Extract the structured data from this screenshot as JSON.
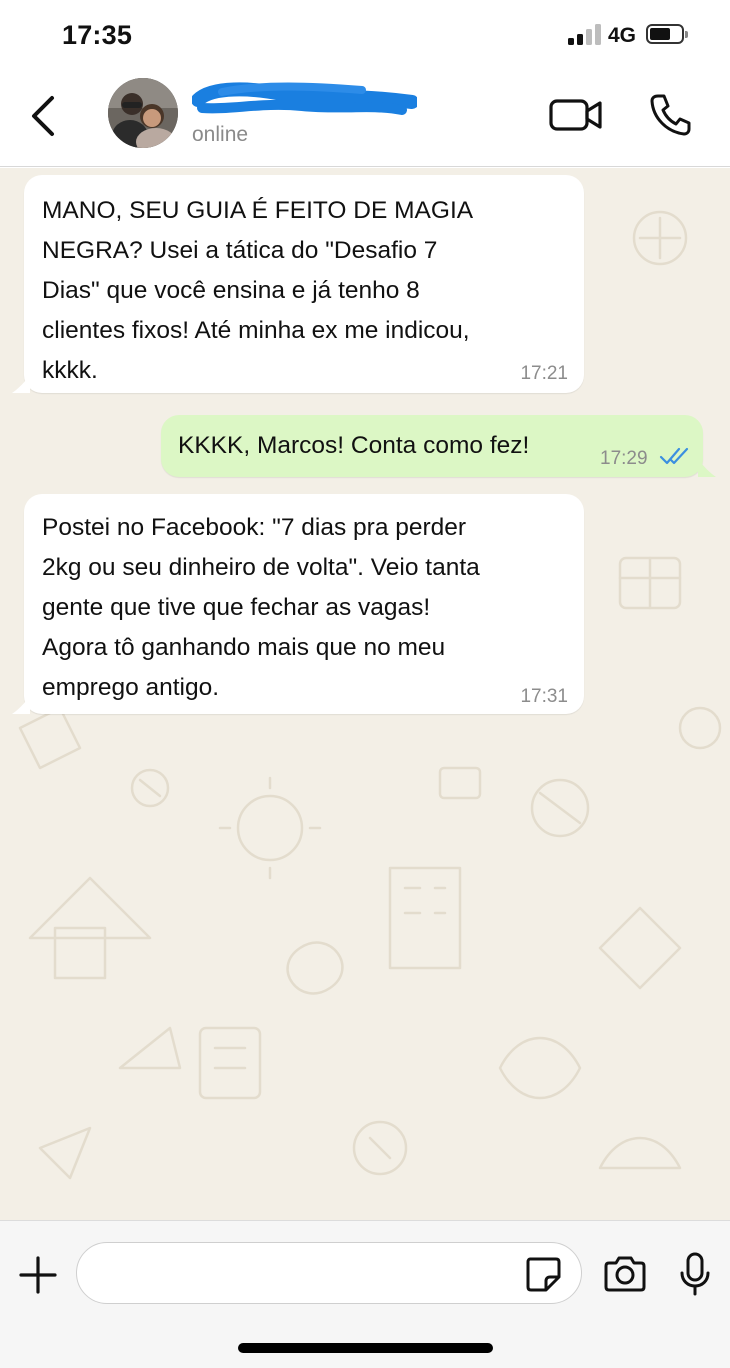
{
  "status_bar": {
    "time": "17:35",
    "network": "4G",
    "signal_icon": "signal-bars-icon",
    "battery_icon": "battery-icon"
  },
  "header": {
    "back_icon": "chevron-left-icon",
    "contact_status": "online",
    "video_icon": "video-camera-icon",
    "call_icon": "phone-icon"
  },
  "messages": [
    {
      "direction": "incoming",
      "lines": [
        "MANO, SEU GUIA É FEITO DE MAGIA",
        "NEGRA? Usei a tática do \"Desafio 7",
        "Dias\" que você ensina e já tenho 8",
        "clientes fixos! Até minha ex me indicou,",
        "kkkk."
      ],
      "time": "17:21"
    },
    {
      "direction": "outgoing",
      "lines": [
        "KKKK, Marcos! Conta como fez!"
      ],
      "time": "17:29",
      "read_icon": "double-check-icon"
    },
    {
      "direction": "incoming",
      "lines": [
        "Postei no Facebook: \"7 dias pra perder",
        "2kg ou seu dinheiro de volta\". Veio tanta",
        "gente que tive que fechar as vagas!",
        "Agora tô ganhando mais que no meu",
        "emprego antigo."
      ],
      "time": "17:31"
    }
  ],
  "composer": {
    "plus_icon": "plus-icon",
    "input_value": "",
    "sticker_icon": "sticker-icon",
    "camera_icon": "camera-icon",
    "mic_icon": "microphone-icon"
  },
  "colors": {
    "chat_background": "#f3efe6",
    "incoming_bubble": "#ffffff",
    "outgoing_bubble": "#dcf7c5",
    "read_receipt": "#3b8fe0",
    "redaction_scribble": "#1a7fe0"
  }
}
